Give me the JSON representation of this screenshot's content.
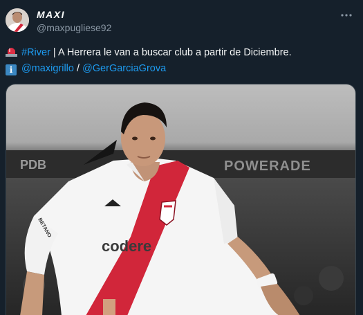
{
  "author": {
    "display_name": "MAXI",
    "handle": "@maxpugliese92"
  },
  "tweet": {
    "line1": {
      "hashtag": "#River",
      "separator": " | ",
      "text": "A Herrera le van a buscar club a partir de Diciembre."
    },
    "line2": {
      "info_glyph": "i",
      "mention1": "@maxigrillo",
      "separator": " / ",
      "mention2": "@GerGarciaGrova"
    }
  },
  "media": {
    "jersey_sponsor": "codere",
    "jersey_sleeve_text": "BETANO",
    "stadium_board_text": "POWERADE",
    "stadium_board_left_text": "PDB"
  },
  "icons": {
    "more": "more-options-icon",
    "alarm": "rotating-light-icon",
    "info": "information-icon"
  },
  "colors": {
    "background": "#15202b",
    "link": "#1d9bf0",
    "secondary_text": "#8b98a5",
    "jersey_stripe": "#d1263a"
  }
}
